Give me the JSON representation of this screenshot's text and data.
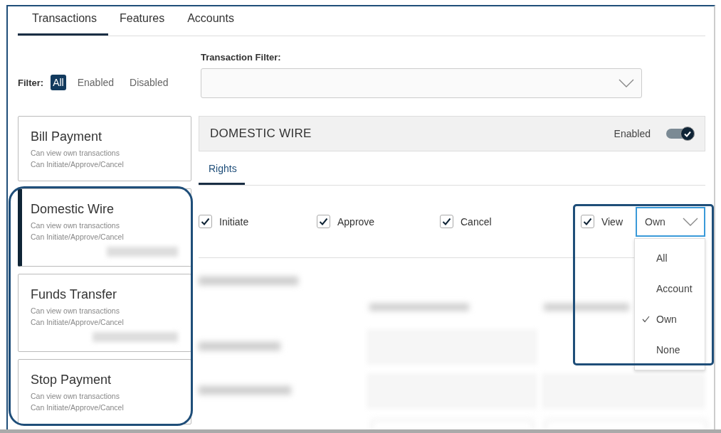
{
  "tabs": [
    {
      "label": "Transactions",
      "selected": true
    },
    {
      "label": "Features",
      "selected": false
    },
    {
      "label": "Accounts",
      "selected": false
    }
  ],
  "filter": {
    "label": "Filter:",
    "options": [
      {
        "label": "All",
        "selected": true
      },
      {
        "label": "Enabled",
        "selected": false
      },
      {
        "label": "Disabled",
        "selected": false
      }
    ]
  },
  "transaction_filter": {
    "label": "Transaction Filter:"
  },
  "transactions": [
    {
      "title": "Bill Payment",
      "lines": [
        "Can view own transactions",
        "Can Initiate/Approve/Cancel"
      ],
      "selected": false,
      "redacted": false
    },
    {
      "title": "Domestic Wire",
      "lines": [
        "Can view own transactions",
        "Can Initiate/Approve/Cancel"
      ],
      "selected": true,
      "redacted": true
    },
    {
      "title": "Funds Transfer",
      "lines": [
        "Can view own transactions",
        "Can Initiate/Approve/Cancel"
      ],
      "selected": false,
      "redacted": true
    },
    {
      "title": "Stop Payment",
      "lines": [
        "Can view own transactions",
        "Can Initiate/Approve/Cancel"
      ],
      "selected": false,
      "redacted": false
    }
  ],
  "detail": {
    "title": "DOMESTIC WIRE",
    "status": {
      "label": "Enabled",
      "on": true
    },
    "tabs": [
      {
        "label": "Rights",
        "selected": true
      }
    ],
    "rights": [
      {
        "label": "Initiate",
        "checked": true
      },
      {
        "label": "Approve",
        "checked": true
      },
      {
        "label": "Cancel",
        "checked": true
      }
    ],
    "view": {
      "label": "View",
      "checked": true,
      "value": "Own",
      "expanded": true,
      "options": [
        {
          "label": "All",
          "selected": false
        },
        {
          "label": "Account",
          "selected": false
        },
        {
          "label": "Own",
          "selected": true
        },
        {
          "label": "None",
          "selected": false
        }
      ]
    }
  }
}
